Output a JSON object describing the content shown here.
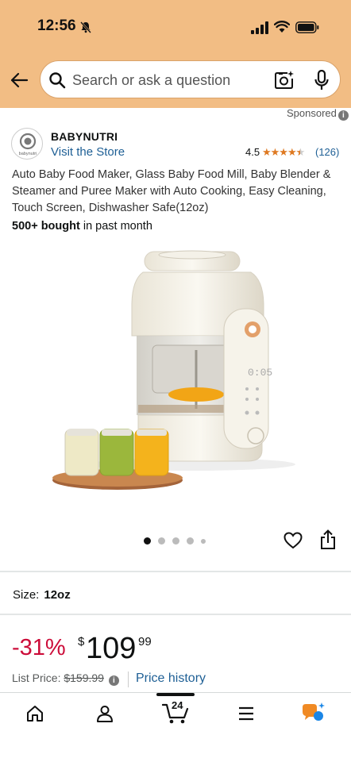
{
  "status": {
    "time": "12:56"
  },
  "search": {
    "placeholder": "Search or ask a question"
  },
  "sponsored": "Sponsored",
  "brand": {
    "name": "BABYNUTRI",
    "logo_text": "babynutri",
    "visit_label": "Visit the Store"
  },
  "rating": {
    "value": "4.5",
    "stars": 4.5,
    "count": "(126)"
  },
  "product": {
    "title": "Auto Baby Food Maker, Glass Baby Food Mill, Baby Blender & Steamer and Puree Maker with Auto Cooking, Easy Cleaning, Touch Screen, Dishwasher Safe(12oz)",
    "bought_bold": "500+ bought",
    "bought_rest": " in past month",
    "display_time": "0:05",
    "image_count": 5,
    "image_index": 0
  },
  "size": {
    "label": "Size:",
    "value": "12oz"
  },
  "price": {
    "discount": "-31%",
    "currency": "$",
    "whole": "109",
    "fraction": "99",
    "list_label": "List Price:",
    "list_value": "$159.99",
    "history_label": "Price history"
  },
  "tabbar": {
    "cart_count": "24",
    "items": [
      "home-icon",
      "account-icon",
      "cart-icon",
      "menu-icon",
      "rufus-icon"
    ]
  },
  "colors": {
    "header_bg": "#f2bd84",
    "link": "#1e5f95",
    "discount": "#cc0c39",
    "star": "#de7921"
  }
}
